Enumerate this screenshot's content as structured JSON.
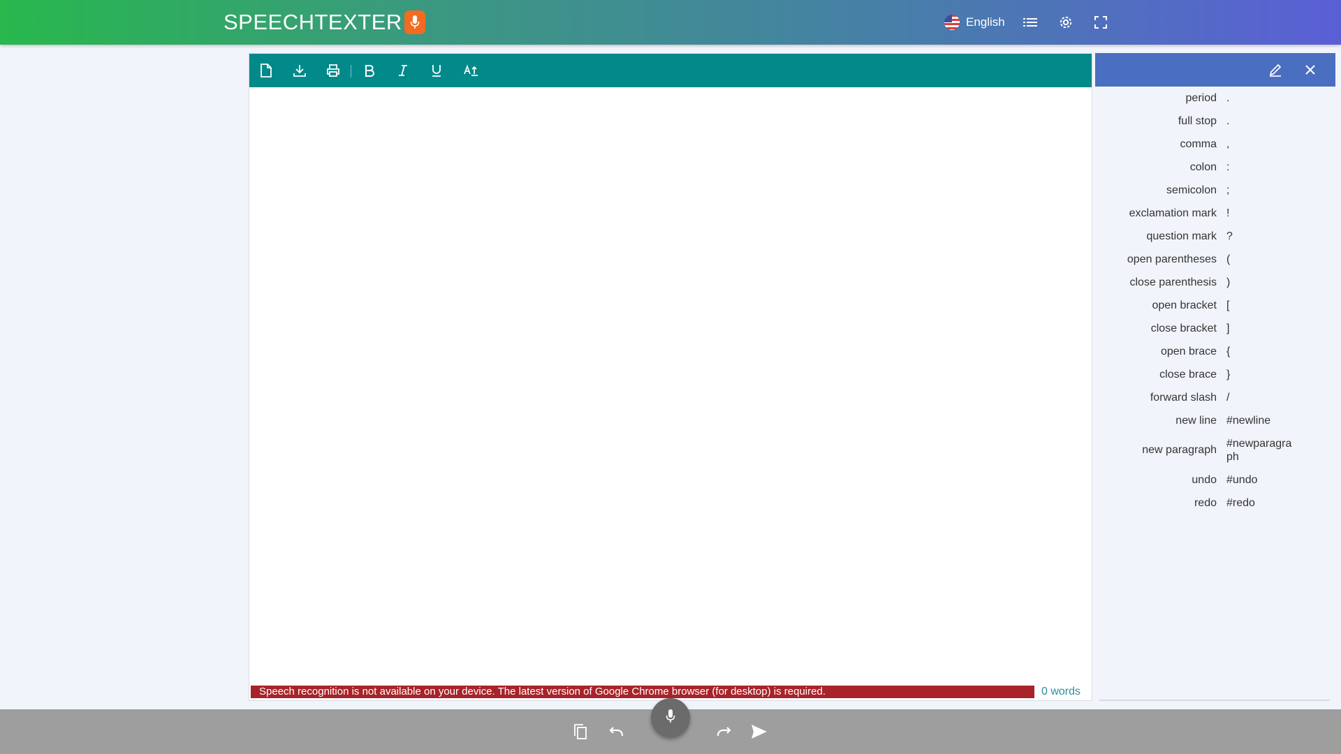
{
  "header": {
    "logo_text": "SPEECHTEXTER",
    "language": "English",
    "icons": [
      "microphone-icon",
      "us-flag-icon",
      "list-icon",
      "settings-icon",
      "fullscreen-icon"
    ]
  },
  "toolbar": {
    "icons": [
      "new-document-icon",
      "download-icon",
      "print-icon",
      "bold-icon",
      "italic-icon",
      "underline-icon",
      "text-case-icon"
    ]
  },
  "editor": {
    "error_message": "Speech recognition is not available on your device. The latest version of Google Chrome browser (for desktop) is required.",
    "word_count": "0 words"
  },
  "commands": {
    "items": [
      {
        "name": "period",
        "value": "."
      },
      {
        "name": "full stop",
        "value": "."
      },
      {
        "name": "comma",
        "value": ","
      },
      {
        "name": "colon",
        "value": ":"
      },
      {
        "name": "semicolon",
        "value": ";"
      },
      {
        "name": "exclamation mark",
        "value": "!"
      },
      {
        "name": "question mark",
        "value": "?"
      },
      {
        "name": "open parentheses",
        "value": "("
      },
      {
        "name": "close parenthesis",
        "value": ")"
      },
      {
        "name": "open bracket",
        "value": "["
      },
      {
        "name": "close bracket",
        "value": "]"
      },
      {
        "name": "open brace",
        "value": "{"
      },
      {
        "name": "close brace",
        "value": "}"
      },
      {
        "name": "forward slash",
        "value": "/"
      },
      {
        "name": "new line",
        "value": "#newline"
      },
      {
        "name": "new paragraph",
        "value": "#newparagraph"
      },
      {
        "name": "undo",
        "value": "#undo"
      },
      {
        "name": "redo",
        "value": "#redo"
      }
    ]
  },
  "bottom_bar": {
    "icons": [
      "copy-icon",
      "undo-icon",
      "microphone-icon",
      "redo-icon",
      "send-icon"
    ]
  },
  "colors": {
    "toolbar": "#02898a",
    "panel_header": "#4a6fc0",
    "error": "#a8232a",
    "bottom_bar": "#9e9e9e",
    "logo_mic": "#f26b21"
  }
}
